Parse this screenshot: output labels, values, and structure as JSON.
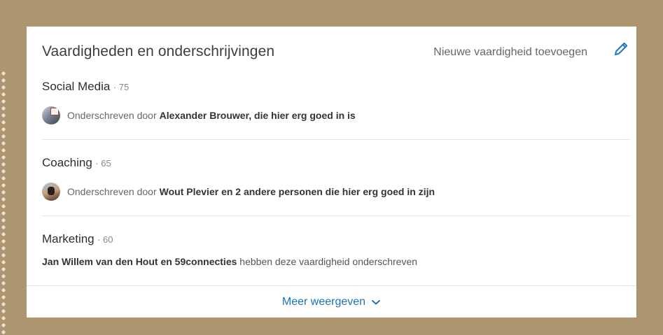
{
  "card": {
    "title": "Vaardigheden en onderschrijvingen",
    "add_skill_label": "Nieuwe vaardigheid toevoegen",
    "edit_icon": "pencil-icon"
  },
  "skills": [
    {
      "name": "Social Media",
      "count": "· 75",
      "endorsement_prefix": "Onderschreven door",
      "endorsement_bold": "Alexander Brouwer, die hier erg goed in is"
    },
    {
      "name": "Coaching",
      "count": "· 65",
      "endorsement_prefix": "Onderschreven door",
      "endorsement_bold": "Wout Plevier en 2 andere personen die hier erg goed in zijn"
    },
    {
      "name": "Marketing",
      "count": "· 60",
      "endorsement_bold": "Jan Willem van den Hout en 59connecties",
      "endorsement_suffix": "hebben deze vaardigheid onderschreven"
    }
  ],
  "footer": {
    "more_label": "Meer weergeven",
    "more_icon": "chevron-down-icon"
  },
  "colors": {
    "background": "#ad9570",
    "link": "#1e73b8"
  }
}
